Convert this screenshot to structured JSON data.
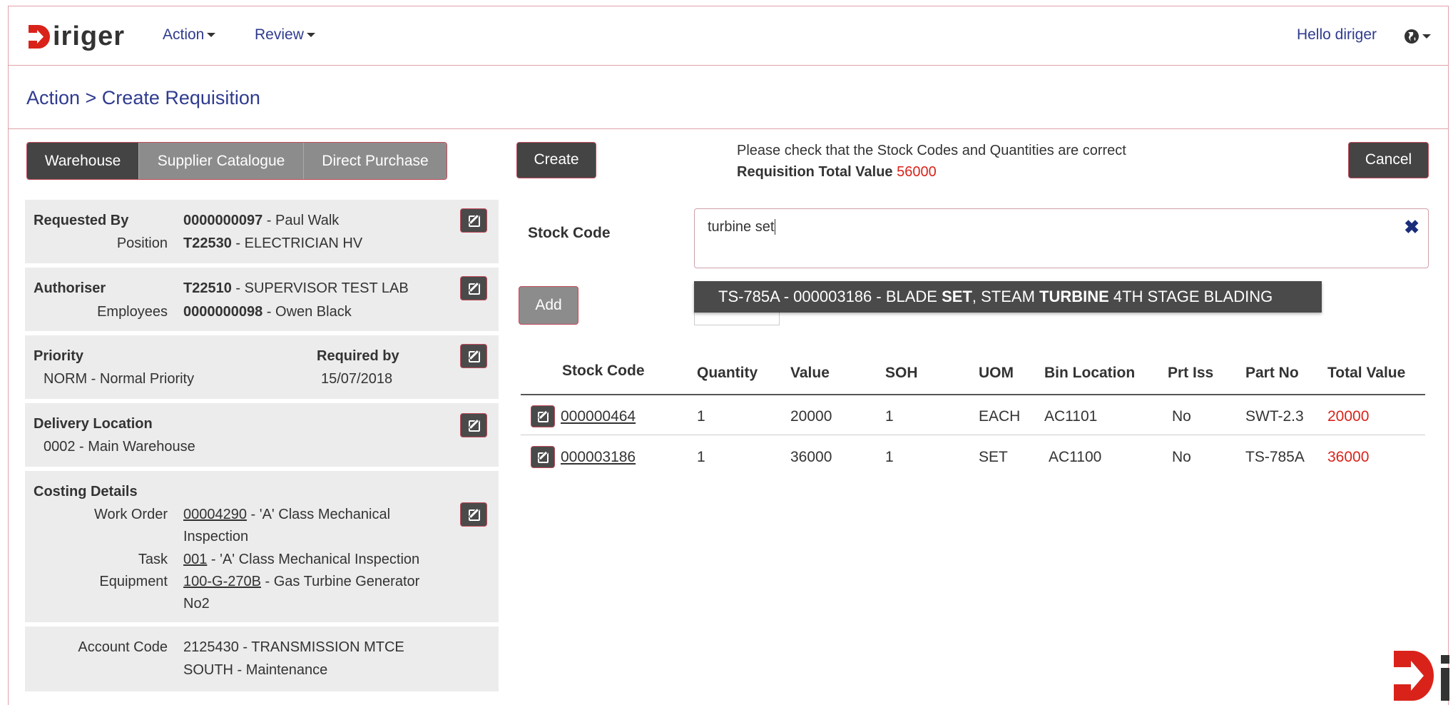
{
  "brand": {
    "name": "iriger",
    "accent": "#d9231a"
  },
  "nav": {
    "action": "Action",
    "review": "Review",
    "greeting": "Hello  diriger"
  },
  "breadcrumb": "Action > Create Requisition",
  "tabs": [
    "Warehouse",
    "Supplier Catalogue",
    "Direct Purchase"
  ],
  "requested": {
    "label": "Requested By",
    "id": "0000000097",
    "name": " - Paul Walk",
    "position_label": "Position",
    "position_id": "T22530",
    "position_name": " - ELECTRICIAN HV"
  },
  "authoriser": {
    "label": "Authoriser",
    "id": "T22510",
    "name": " - SUPERVISOR TEST LAB",
    "employees_label": "Employees",
    "emp_id": "0000000098",
    "emp_name": " - Owen Black"
  },
  "priority": {
    "label": "Priority",
    "value": "NORM - Normal Priority",
    "required_label": "Required by",
    "required_value": "15/07/2018"
  },
  "delivery": {
    "label": "Delivery Location",
    "value": "0002 - Main Warehouse"
  },
  "costing": {
    "label": "Costing Details",
    "wo_label": "Work Order",
    "wo_id": "00004290",
    "wo_desc1": " - 'A' Class Mechanical",
    "wo_desc2": "Inspection",
    "task_label": "Task",
    "task_id": "001",
    "task_desc": " - 'A' Class Mechanical Inspection",
    "eq_label": "Equipment",
    "eq_id": "100-G-270B",
    "eq_desc1": " - Gas Turbine Generator",
    "eq_desc2": "No2"
  },
  "account": {
    "label": "Account Code",
    "line1": "2125430 - TRANSMISSION MTCE",
    "line2": "SOUTH - Maintenance"
  },
  "actions": {
    "create": "Create",
    "cancel": "Cancel",
    "add": "Add"
  },
  "message": {
    "line1": "Please check that the Stock Codes and Quantities are correct",
    "total_label": "Requisition Total Value",
    "total_value": "56000"
  },
  "stock": {
    "label": "Stock Code",
    "input_value": "turbine set",
    "suggestion_prefix": "TS-785A - 000003186 - BLADE ",
    "suggestion_b1": "SET",
    "suggestion_mid": ", STEAM ",
    "suggestion_b2": "TURBINE",
    "suggestion_suffix": " 4TH STAGE BLADING"
  },
  "table": {
    "headers": [
      "Stock Code",
      "Quantity",
      "Value",
      "SOH",
      "UOM",
      "Bin Location",
      "Prt Iss",
      "Part No",
      "Total Value"
    ],
    "rows": [
      [
        "000000464",
        "1",
        "20000",
        "1",
        "EACH",
        "AC1101",
        "No",
        "SWT-2.3",
        "20000"
      ],
      [
        "000003186",
        "1",
        "36000",
        "1",
        "SET",
        "AC1100",
        "No",
        "TS-785A",
        "36000"
      ]
    ]
  }
}
